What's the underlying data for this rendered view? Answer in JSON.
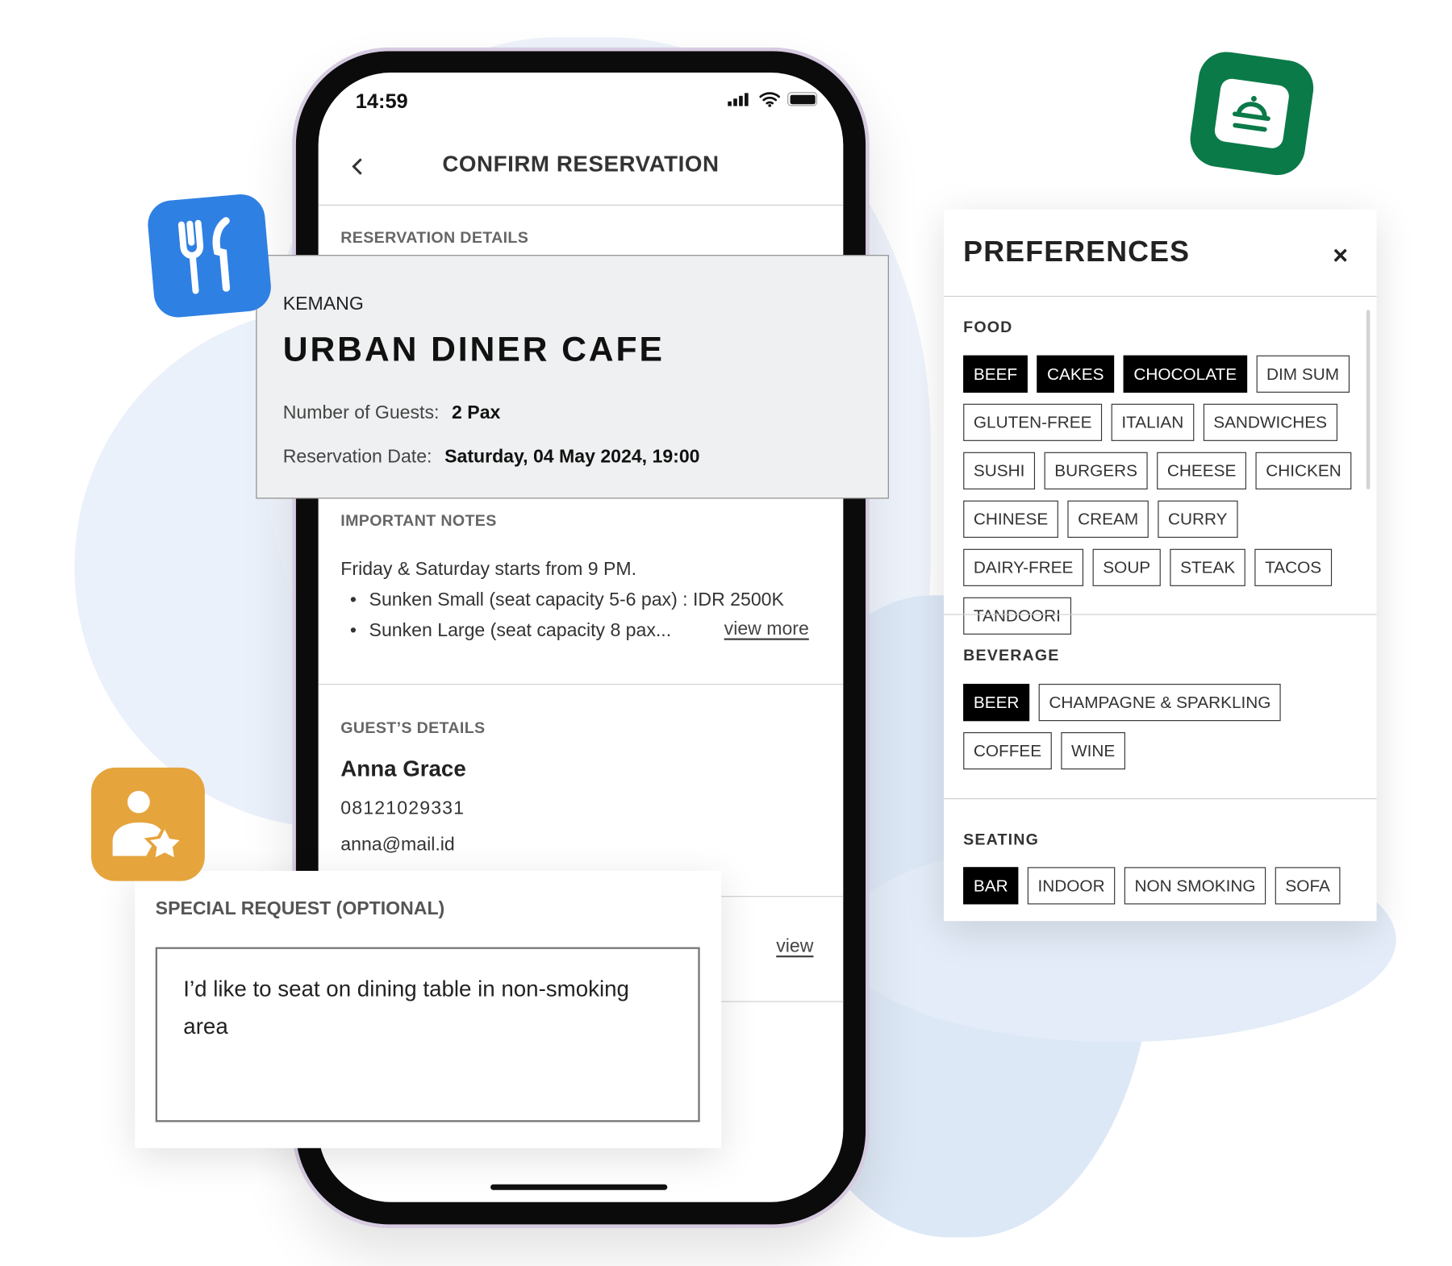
{
  "status_bar": {
    "time": "14:59",
    "icons": [
      "signal-icon",
      "wifi-icon",
      "battery-icon"
    ]
  },
  "header": {
    "title": "CONFIRM RESERVATION",
    "back_icon": "chevron-left-icon"
  },
  "reservation": {
    "section_label": "RESERVATION DETAILS",
    "area": "KEMANG",
    "restaurant": "URBAN DINER CAFE",
    "guests_label": "Number of Guests:",
    "guests_value": "2 Pax",
    "date_label": "Reservation Date:",
    "date_value": "Saturday, 04 May 2024, 19:00"
  },
  "notes": {
    "section_label": "IMPORTANT NOTES",
    "intro": "Friday & Saturday starts from 9 PM.",
    "bullets": [
      "Sunken Small (seat capacity 5-6 pax) : IDR 2500K",
      "Sunken Large (seat capacity 8 pax..."
    ],
    "view_more": "view more"
  },
  "guest": {
    "section_label": "GUEST’S DETAILS",
    "name": "Anna Grace",
    "phone": "08121029331",
    "email": "anna@mail.id",
    "view_link": "view"
  },
  "special_request": {
    "label": "SPECIAL REQUEST (OPTIONAL)",
    "value": "I’d like to seat on dining table in non-smoking area"
  },
  "preferences": {
    "title": "PREFERENCES",
    "close": "×",
    "groups": [
      {
        "label": "FOOD",
        "tags": [
          {
            "t": "BEEF",
            "s": true
          },
          {
            "t": "CAKES",
            "s": true
          },
          {
            "t": "CHOCOLATE",
            "s": true
          },
          {
            "t": "DIM SUM",
            "s": false
          },
          {
            "t": "GLUTEN-FREE",
            "s": false
          },
          {
            "t": "ITALIAN",
            "s": false
          },
          {
            "t": "SANDWICHES",
            "s": false
          },
          {
            "t": "SUSHI",
            "s": false
          },
          {
            "t": "BURGERS",
            "s": false
          },
          {
            "t": "CHEESE",
            "s": false
          },
          {
            "t": "CHICKEN",
            "s": false
          },
          {
            "t": "CHINESE",
            "s": false
          },
          {
            "t": "CREAM",
            "s": false
          },
          {
            "t": "CURRY",
            "s": false
          },
          {
            "t": "DAIRY-FREE",
            "s": false
          },
          {
            "t": "SOUP",
            "s": false
          },
          {
            "t": "STEAK",
            "s": false
          },
          {
            "t": "TACOS",
            "s": false
          },
          {
            "t": "TANDOORI",
            "s": false
          }
        ]
      },
      {
        "label": "BEVERAGE",
        "tags": [
          {
            "t": "BEER",
            "s": true
          },
          {
            "t": "CHAMPAGNE & SPARKLING",
            "s": false
          },
          {
            "t": "COFFEE",
            "s": false
          },
          {
            "t": "WINE",
            "s": false
          }
        ]
      },
      {
        "label": "SEATING",
        "tags": [
          {
            "t": "BAR",
            "s": true
          },
          {
            "t": "INDOOR",
            "s": false
          },
          {
            "t": "NON SMOKING",
            "s": false
          },
          {
            "t": "SOFA",
            "s": false
          }
        ]
      }
    ]
  },
  "colors": {
    "blue_tile": "#2f80e3",
    "orange_tile": "#e6a43d",
    "green_tile": "#0b7a49",
    "selected_tag": "#000000"
  },
  "decor_icons": [
    "fork-knife-icon",
    "user-star-icon",
    "food-cloche-icon"
  ]
}
